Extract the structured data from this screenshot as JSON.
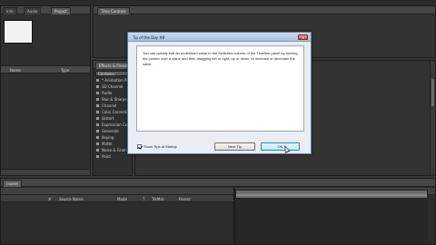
{
  "app": {
    "window_title": ""
  },
  "project_panel": {
    "tabs": [
      "Info",
      "Audio",
      "Project"
    ],
    "columns": [
      "Name",
      "Type"
    ]
  },
  "comp_panel": {
    "tab": "Time Controls"
  },
  "effects_panel": {
    "tab": "Effects & Presets",
    "search_value": "Contains:",
    "categories": [
      "* Animation Presets",
      "3D Channel",
      "Audio",
      "Blur & Sharpen",
      "Channel",
      "Color Correction",
      "Distort",
      "Expression Controls",
      "Generate",
      "Keying",
      "Matte",
      "Noise & Grain",
      "Paint"
    ]
  },
  "timeline": {
    "tab": "(none)",
    "columns": [
      "#",
      "Source Name",
      "Mode",
      "T",
      "TrkMat",
      "Parent"
    ]
  },
  "dialog": {
    "title": "Tip of the Day #8",
    "close_label": "x",
    "tip_text": "You can quickly edit an underlined value in the Switches column of the Timeline panel by moving the pointer over a value and then dragging left or right, up or down, to increase or decrease the value.",
    "show_tips_label": "Show Tips at Startup",
    "show_tips_checked": true,
    "next_tip_label": "Next Tip",
    "ok_label": "OK"
  },
  "colors": {
    "panel_bg": "#2f2f2f",
    "dialog_bg": "#e9eef5",
    "title_gradient": "#a6c2e2"
  }
}
